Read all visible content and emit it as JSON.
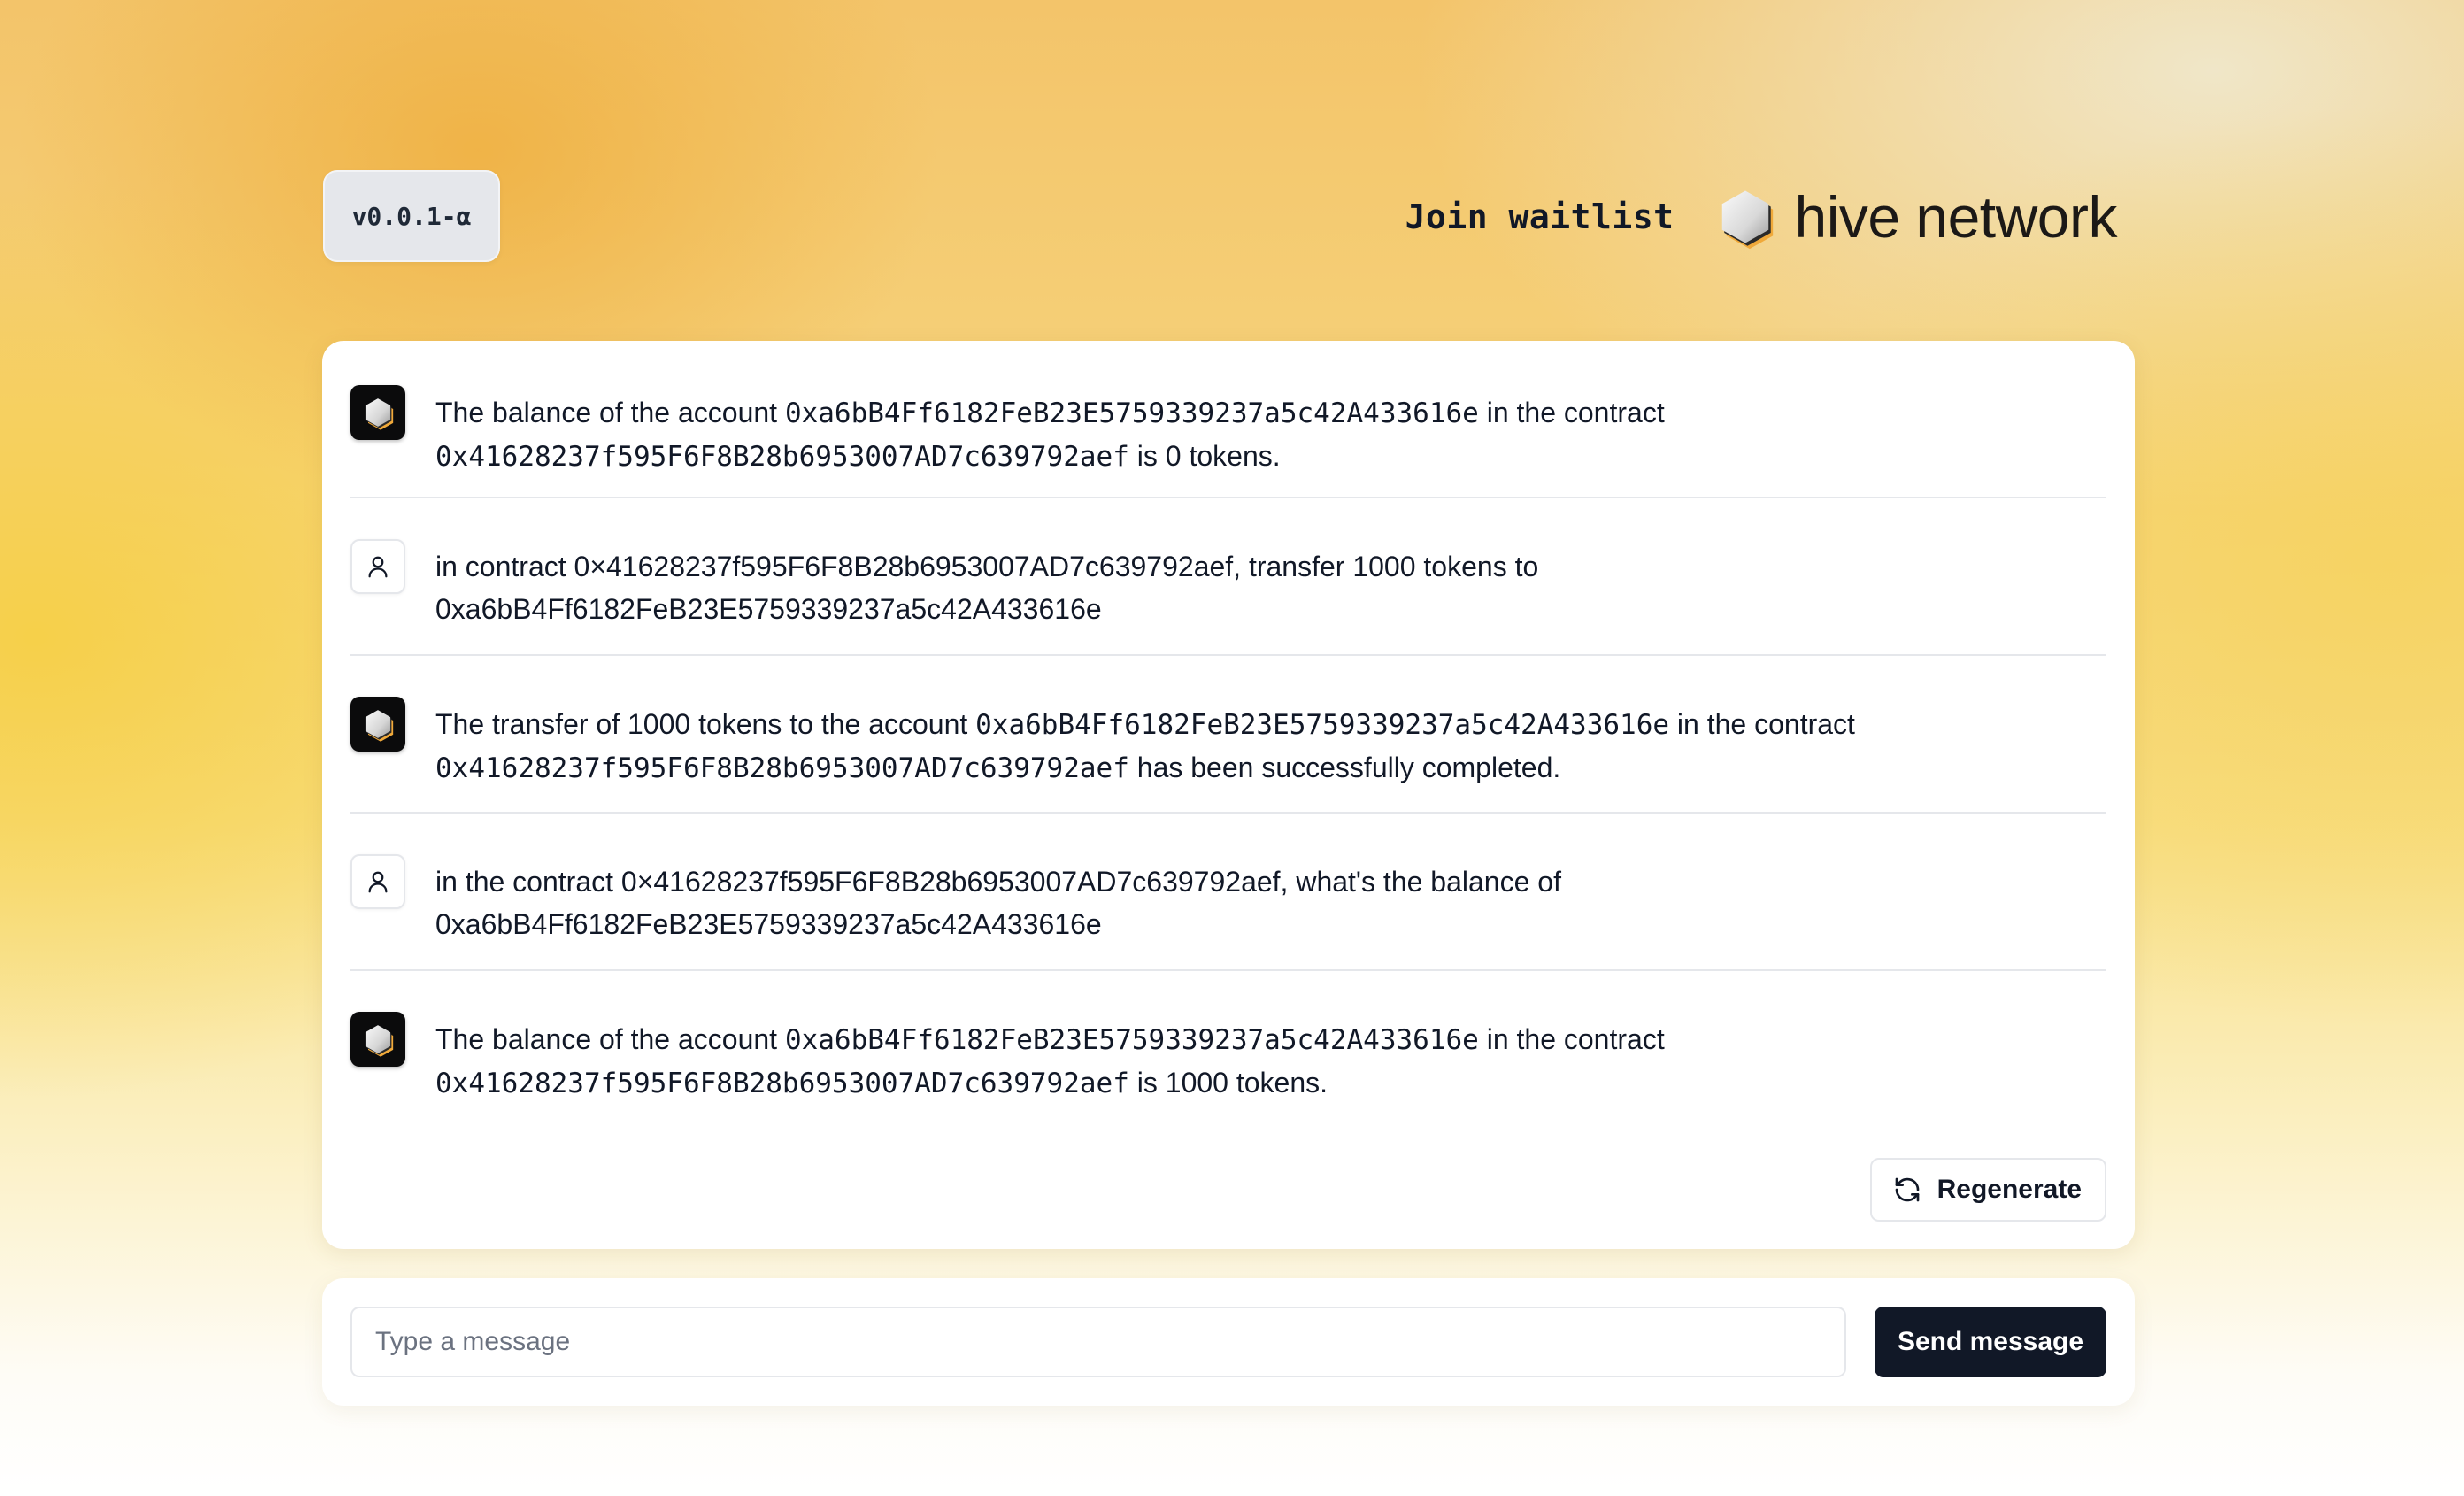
{
  "header": {
    "version": "v0.0.1-α",
    "join_label": "Join waitlist",
    "brand_name": "hive network"
  },
  "messages": [
    {
      "role": "bot",
      "parts": [
        {
          "text": "The balance of the account ",
          "mono": false
        },
        {
          "text": "0xa6bB4Ff6182FeB23E5759339237a5c42A433616e",
          "mono": true
        },
        {
          "text": " in the contract ",
          "mono": false
        },
        {
          "text": "0x41628237f595F6F8B28b6953007AD7c639792aef",
          "mono": true
        },
        {
          "text": " is 0 tokens.",
          "mono": false
        }
      ]
    },
    {
      "role": "user",
      "parts": [
        {
          "text": "in contract 0×41628237f595F6F8B28b6953007AD7c639792aef, transfer 1000 tokens to 0xa6bB4Ff6182FeB23E5759339237a5c42A433616e",
          "mono": false
        }
      ]
    },
    {
      "role": "bot",
      "parts": [
        {
          "text": "The transfer of 1000 tokens to the account ",
          "mono": false
        },
        {
          "text": "0xa6bB4Ff6182FeB23E5759339237a5c42A433616e",
          "mono": true
        },
        {
          "text": " in the contract ",
          "mono": false
        },
        {
          "text": "0x41628237f595F6F8B28b6953007AD7c639792aef",
          "mono": true
        },
        {
          "text": " has been successfully completed.",
          "mono": false
        }
      ]
    },
    {
      "role": "user",
      "parts": [
        {
          "text": "in the contract 0×41628237f595F6F8B28b6953007AD7c639792aef, what's the balance of 0xa6bB4Ff6182FeB23E5759339237a5c42A433616e",
          "mono": false
        }
      ]
    },
    {
      "role": "bot",
      "parts": [
        {
          "text": "The balance of the account ",
          "mono": false
        },
        {
          "text": "0xa6bB4Ff6182FeB23E5759339237a5c42A433616e",
          "mono": true
        },
        {
          "text": " in the contract ",
          "mono": false
        },
        {
          "text": "0x41628237f595F6F8B28b6953007AD7c639792aef",
          "mono": true
        },
        {
          "text": " is 1000 tokens.",
          "mono": false
        }
      ]
    }
  ],
  "actions": {
    "regenerate_label": "Regenerate",
    "regenerate_icon": "refresh-icon"
  },
  "composer": {
    "placeholder": "Type a message",
    "value": "",
    "send_label": "Send message"
  },
  "icons": {
    "bot_avatar": "hive-logo-icon",
    "user_avatar": "user-icon"
  },
  "colors": {
    "primary_button": "#111827",
    "logo_accent": "#f0a93a"
  }
}
